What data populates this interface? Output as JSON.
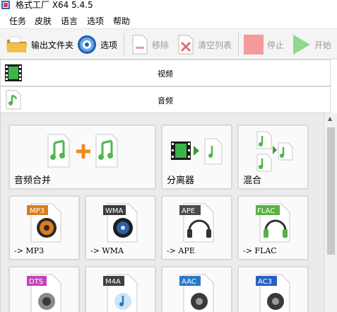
{
  "window": {
    "title": "格式工厂 X64 5.4.5"
  },
  "menu": {
    "items": [
      "任务",
      "皮肤",
      "语言",
      "选项",
      "帮助"
    ]
  },
  "toolbar": {
    "output_folder": "输出文件夹",
    "options": "选项",
    "remove": "移除",
    "clear_list": "清空列表",
    "stop": "停止",
    "start": "开始"
  },
  "categories": {
    "video": "视频",
    "audio": "音频"
  },
  "tiles": {
    "merge": "音频合并",
    "splitter": "分离器",
    "mix": "混合",
    "mp3": "-> MP3",
    "wma": "-> WMA",
    "ape": "-> APE",
    "flac": "-> FLAC",
    "mp3_badge": "MP3",
    "wma_badge": "WMA",
    "ape_badge": "APE",
    "flac_badge": "FLAC",
    "dts_badge": "DTS",
    "m4a_badge": "M4A",
    "aac_badge": "AAC",
    "ac3_badge": "AC3"
  },
  "colors": {
    "mp3": "#e07b1c",
    "wma": "#3c3c3c",
    "ape": "#4c4c4c",
    "flac": "#56b43c",
    "dts": "#c044b8",
    "m4a": "#404040",
    "aac": "#2a78c8",
    "ac3": "#2a5fc0",
    "music_green": "#4cb84c",
    "stop_red": "#f39a9a",
    "start_green": "#8fd88f"
  }
}
